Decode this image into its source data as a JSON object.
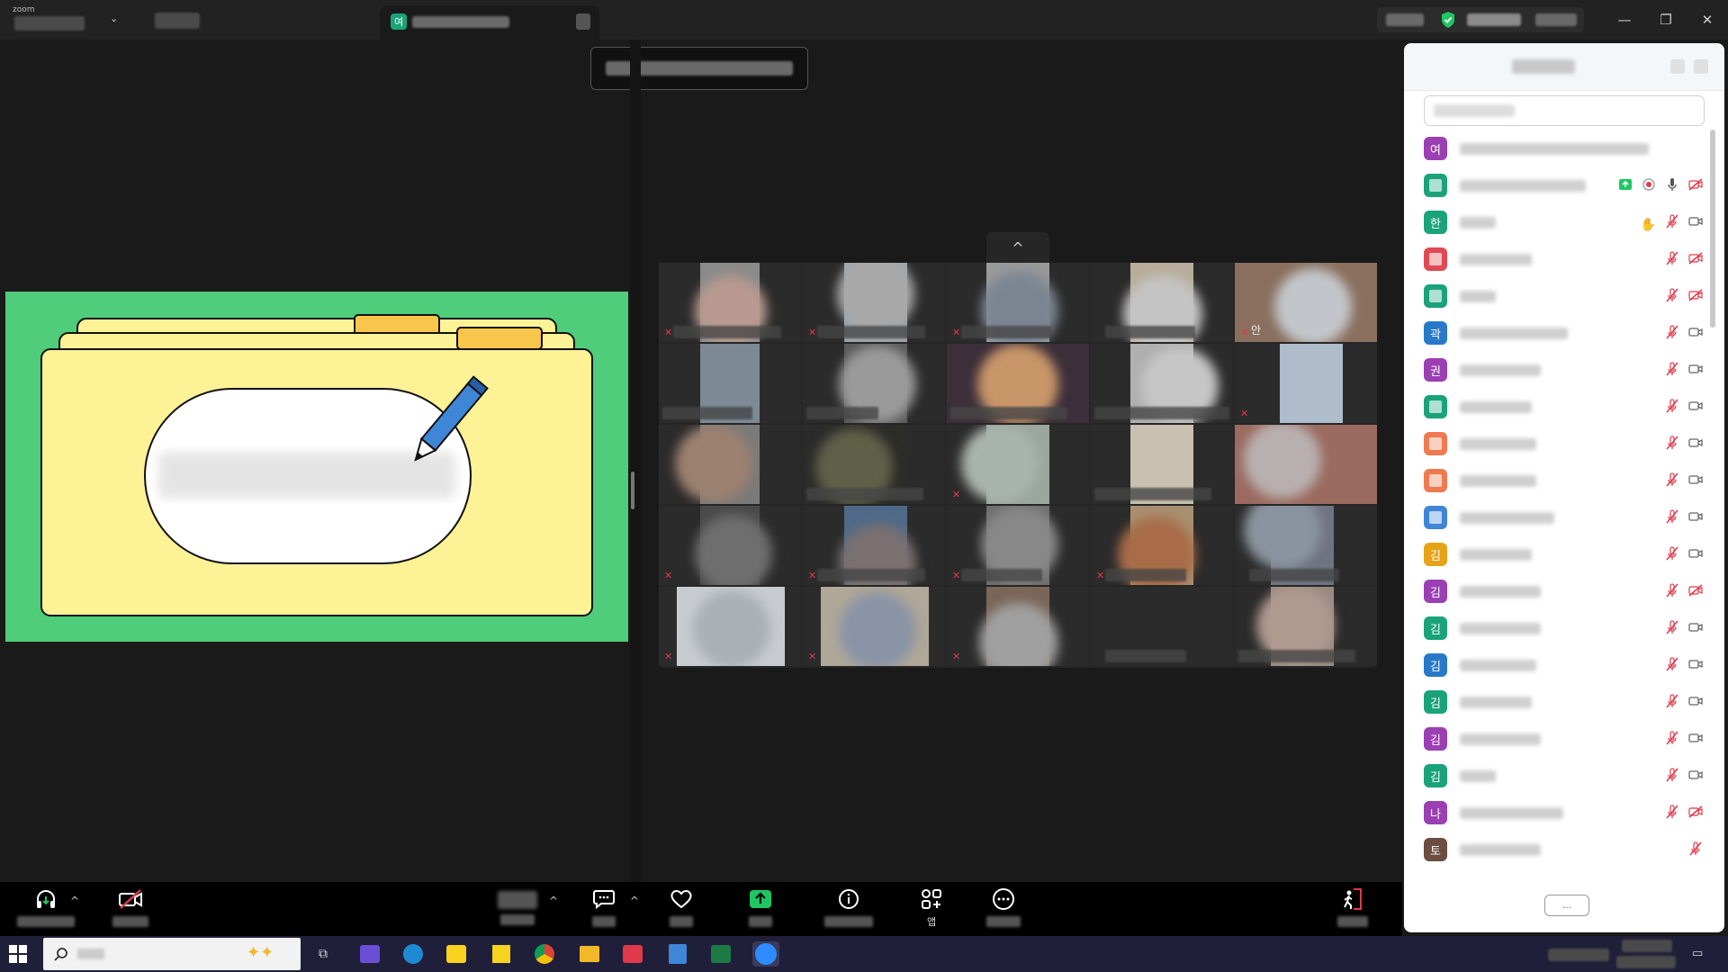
{
  "titlebar": {
    "app": "zoom",
    "tab_badge": "여",
    "controls": [
      "—",
      "❐",
      "✕"
    ]
  },
  "gallery": {
    "collapse_glyph": "^",
    "overlay_label": "안"
  },
  "panel": {
    "participants": [
      {
        "initial": "여",
        "color": "#9b3fb3",
        "name_w": 210,
        "icons": []
      },
      {
        "initial": "",
        "color": "#1aa37a",
        "name_w": 140,
        "icons": [
          "share",
          "record",
          "mic",
          "video-off"
        ]
      },
      {
        "initial": "한",
        "color": "#1aa37a",
        "name_w": 40,
        "icons": [
          "hand",
          "mic-off",
          "video"
        ]
      },
      {
        "initial": "",
        "color": "#e04a52",
        "name_w": 80,
        "icons": [
          "mic-off",
          "video-off"
        ]
      },
      {
        "initial": "",
        "color": "#1aa37a",
        "name_w": 40,
        "icons": [
          "mic-off",
          "video-off"
        ]
      },
      {
        "initial": "곽",
        "color": "#2979c9",
        "name_w": 120,
        "icons": [
          "mic-off",
          "video"
        ]
      },
      {
        "initial": "권",
        "color": "#9b3fb3",
        "name_w": 90,
        "icons": [
          "mic-off",
          "video"
        ]
      },
      {
        "initial": "",
        "color": "#1aa37a",
        "name_w": 80,
        "icons": [
          "mic-off",
          "video"
        ]
      },
      {
        "initial": "",
        "color": "#f07a50",
        "name_w": 85,
        "icons": [
          "mic-off",
          "video"
        ]
      },
      {
        "initial": "",
        "color": "#f07a50",
        "name_w": 85,
        "icons": [
          "mic-off",
          "video"
        ]
      },
      {
        "initial": "",
        "color": "#3f86d6",
        "name_w": 105,
        "icons": [
          "mic-off",
          "video"
        ]
      },
      {
        "initial": "김",
        "color": "#e6a317",
        "name_w": 80,
        "icons": [
          "mic-off",
          "video"
        ]
      },
      {
        "initial": "김",
        "color": "#9b3fb3",
        "name_w": 90,
        "icons": [
          "mic-off",
          "video-off"
        ]
      },
      {
        "initial": "김",
        "color": "#1aa37a",
        "name_w": 90,
        "icons": [
          "mic-off",
          "video"
        ]
      },
      {
        "initial": "김",
        "color": "#2979c9",
        "name_w": 85,
        "icons": [
          "mic-off",
          "video"
        ]
      },
      {
        "initial": "김",
        "color": "#1aa37a",
        "name_w": 80,
        "icons": [
          "mic-off",
          "video"
        ]
      },
      {
        "initial": "김",
        "color": "#9b3fb3",
        "name_w": 90,
        "icons": [
          "mic-off",
          "video"
        ]
      },
      {
        "initial": "김",
        "color": "#1aa37a",
        "name_w": 40,
        "icons": [
          "mic-off",
          "video"
        ]
      },
      {
        "initial": "나",
        "color": "#9b3fb3",
        "name_w": 115,
        "icons": [
          "mic-off",
          "video-off"
        ]
      },
      {
        "initial": "토",
        "color": "#6d4c41",
        "name_w": 90,
        "icons": [
          "mic-off"
        ]
      }
    ],
    "footer_button": "..."
  },
  "toolbar": {
    "apps_label": "앱"
  },
  "colors": {
    "accent_green": "#1ec764",
    "muted_red": "#e0394a",
    "slide_bg": "#4fcd7a",
    "folder_yellow": "#fdf296"
  }
}
